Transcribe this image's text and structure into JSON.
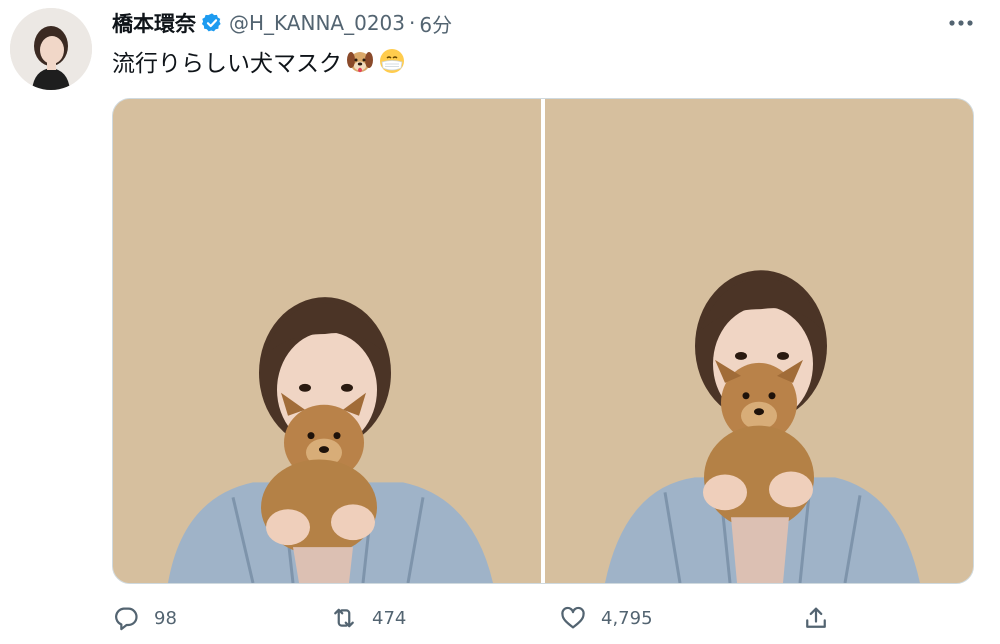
{
  "tweet": {
    "display_name": "橋本環奈",
    "handle": "@H_KANNA_0203",
    "separator": "·",
    "timestamp": "6分",
    "text": "流行りらしい犬マスク",
    "emojis": [
      "dog-face-emoji",
      "face-with-medical-mask-emoji"
    ],
    "verified": true,
    "media": {
      "count": 2
    },
    "stats": {
      "replies": "98",
      "retweets": "474",
      "likes": "4,795"
    }
  },
  "colors": {
    "text_primary": "#0f1419",
    "text_secondary": "#536471",
    "verified_blue": "#1d9bf0",
    "photo_background": "#d6bf9e"
  },
  "icons": {
    "more": "more-icon",
    "verified": "verified-badge-icon",
    "reply": "reply-icon",
    "retweet": "retweet-icon",
    "like": "like-icon",
    "share": "share-icon"
  }
}
